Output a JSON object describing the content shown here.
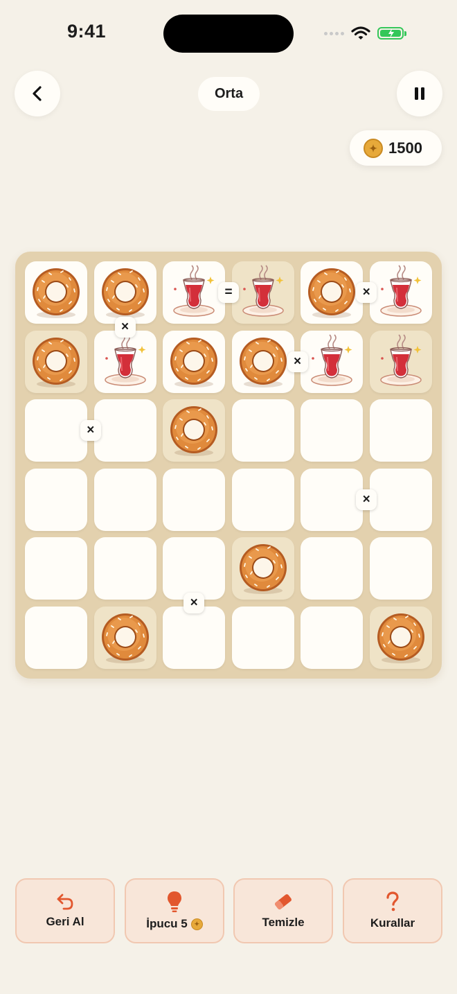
{
  "status_bar": {
    "time": "9:41"
  },
  "header": {
    "title": "Orta"
  },
  "coins": {
    "amount": "1500"
  },
  "board": {
    "size": 6,
    "cells": [
      [
        "bagel",
        "bagel",
        "tea",
        "tea",
        "bagel",
        "tea"
      ],
      [
        "bagel",
        "tea",
        "bagel",
        "bagel",
        "tea",
        "tea"
      ],
      [
        "",
        "",
        "bagel",
        "",
        "",
        ""
      ],
      [
        "",
        "",
        "",
        "",
        "",
        ""
      ],
      [
        "",
        "",
        "",
        "bagel",
        "",
        ""
      ],
      [
        "",
        "bagel",
        "",
        "",
        "",
        "bagel"
      ]
    ],
    "locked": [
      [
        false,
        false,
        false,
        true,
        false,
        false
      ],
      [
        true,
        false,
        false,
        false,
        false,
        true
      ],
      [
        false,
        false,
        true,
        false,
        false,
        false
      ],
      [
        false,
        false,
        false,
        false,
        false,
        false
      ],
      [
        false,
        false,
        false,
        true,
        false,
        false
      ],
      [
        false,
        true,
        false,
        false,
        false,
        true
      ]
    ],
    "constraints": [
      {
        "row": 0,
        "col": 2,
        "dir": "right",
        "symbol": "="
      },
      {
        "row": 0,
        "col": 4,
        "dir": "right",
        "symbol": "×"
      },
      {
        "row": 0,
        "col": 1,
        "dir": "down",
        "symbol": "×"
      },
      {
        "row": 1,
        "col": 3,
        "dir": "right",
        "symbol": "×"
      },
      {
        "row": 2,
        "col": 0,
        "dir": "right",
        "symbol": "×"
      },
      {
        "row": 3,
        "col": 4,
        "dir": "right",
        "symbol": "×"
      },
      {
        "row": 4,
        "col": 2,
        "dir": "down",
        "symbol": "×"
      }
    ]
  },
  "toolbar": {
    "undo_label": "Geri Al",
    "hint_label": "İpucu 5",
    "clear_label": "Temizle",
    "rules_label": "Kurallar"
  },
  "colors": {
    "accent": "#e2572e",
    "board": "#e3d1ae",
    "background": "#f5f1e8"
  }
}
